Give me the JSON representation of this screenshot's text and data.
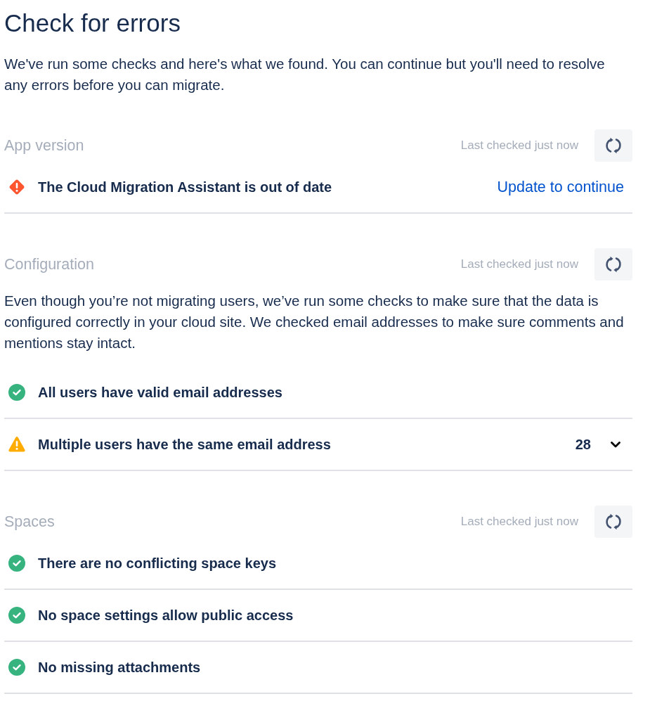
{
  "title": "Check for errors",
  "intro": "We've run some checks and here's what we found. You can continue but you'll need to resolve any errors before you can migrate.",
  "sections": [
    {
      "title": "App version",
      "last_checked": "Last checked just now",
      "items": [
        {
          "kind": "error",
          "text": "The Cloud Migration Assistant is out of date",
          "action": "Update to continue"
        }
      ]
    },
    {
      "title": "Configuration",
      "last_checked": "Last checked just now",
      "description": "Even though you’re not migrating users, we’ve run some checks to make sure that the data is configured correctly in your cloud site. We checked email addresses to make sure comments and mentions stay intact.",
      "items": [
        {
          "kind": "success",
          "text": "All users have valid email addresses"
        },
        {
          "kind": "warning",
          "text": "Multiple users have the same email address",
          "count": "28",
          "expanded": false
        }
      ]
    },
    {
      "title": "Spaces",
      "last_checked": "Last checked just now",
      "items": [
        {
          "kind": "success",
          "text": "There are no conflicting space keys"
        },
        {
          "kind": "success",
          "text": "No space settings allow public access"
        },
        {
          "kind": "success",
          "text": "No missing attachments"
        }
      ]
    }
  ]
}
